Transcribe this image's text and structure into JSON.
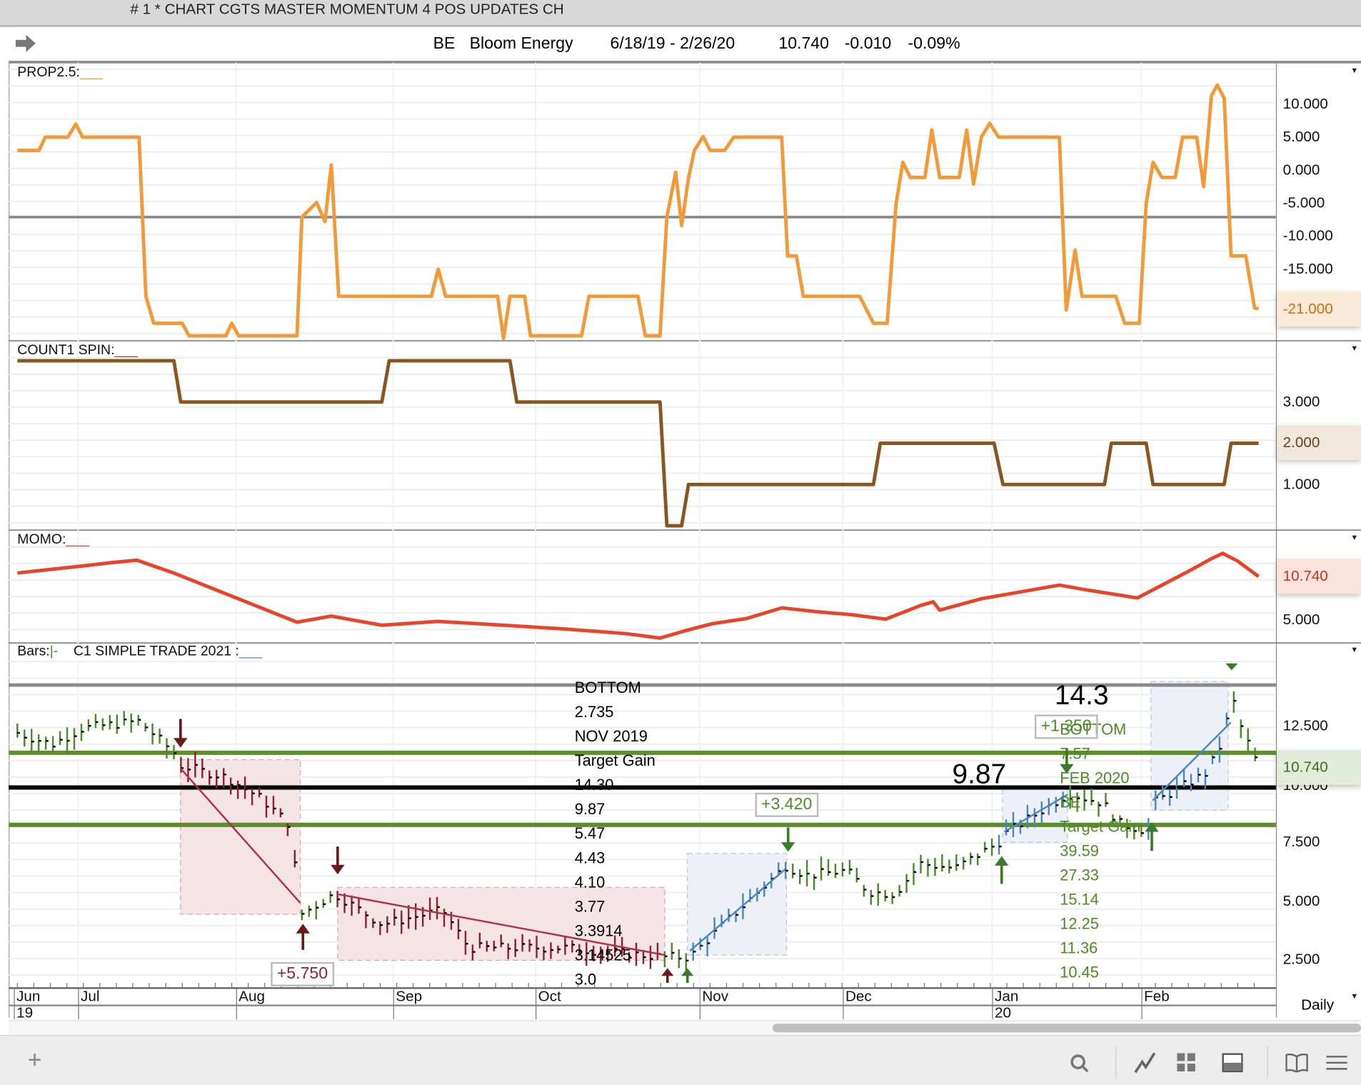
{
  "window": {
    "title": "# 1 * CHART CGTS MASTER MOMENTUM 4 POS UPDATES CH"
  },
  "header": {
    "symbol": "BE",
    "name": "Bloom Energy",
    "range": "6/18/19 - 2/26/20",
    "last": "10.740",
    "change": "-0.010",
    "change_pct": "-0.09%"
  },
  "colors": {
    "prop": "#f29a38",
    "count": "#8a561f",
    "momo": "#e8442a",
    "up": "#4a8a2a",
    "down": "#8c2233",
    "trend_up": "#4a86c0",
    "level_green": "#5e8e2a"
  },
  "panels": {
    "prop": {
      "label": "PROP2.5:",
      "underline": "___",
      "axis": [
        "10.000",
        "5.000",
        "0.000",
        "-5.000",
        "-10.000",
        "-15.000"
      ],
      "current": "-21.000"
    },
    "count": {
      "label": "COUNT1 SPIN:",
      "underline": "___",
      "axis": [
        "3.000",
        "1.000"
      ],
      "current": "2.000"
    },
    "momo": {
      "label": "MOMO:",
      "underline": "___",
      "axis": [
        "5.000"
      ],
      "current": "10.740"
    },
    "bars": {
      "label": "Bars:",
      "bar_style": "|-",
      "study": "C1 SIMPLE TRADE 2021 :",
      "underline": "___",
      "axis": [
        "12.500",
        "10.000",
        "7.500",
        "5.000",
        "2.500"
      ],
      "current": "10.740"
    }
  },
  "annotations": {
    "nov_block": [
      "BOTTOM",
      " 2.735",
      "NOV 2019",
      "Target Gain",
      "14.30",
      "9.87",
      "5.47",
      "4.43",
      "4.10",
      "3.77",
      "3.3914",
      "3.14525",
      "3.0"
    ],
    "feb_block": [
      "BOTTOM",
      "7.57",
      "FEB 2020",
      "BE",
      "Target Gain",
      "39.59",
      "27.33",
      "15.14",
      "12.25",
      "11.36",
      "10.45"
    ],
    "big_target": "14.3",
    "big_level": "9.87",
    "gain_1": "+5.750",
    "gain_2": "+3.420",
    "gain_3": "+1.350"
  },
  "xaxis": {
    "months": [
      "Jun",
      "Jul",
      "Aug",
      "Sep",
      "Oct",
      "Nov",
      "Dec",
      "Jan",
      "Feb"
    ],
    "years": [
      "19",
      "20"
    ],
    "period": "Daily"
  },
  "chart_data": [
    {
      "type": "line",
      "name": "PROP2.5",
      "x_unit": "calendar days since 6/18/19",
      "ylim": [
        -26,
        14
      ],
      "x": [
        0,
        4.4,
        5.7,
        10.3,
        11.9,
        13.3,
        24.8,
        26.2,
        27.8,
        33.6,
        35,
        42.5,
        43.7,
        45.1,
        57,
        58,
        61,
        62.7,
        64,
        65.5,
        84.4,
        85.8,
        87.3,
        97.9,
        99.1,
        100.4,
        103.4,
        104.6,
        115,
        116.5,
        126.5,
        128,
        131,
        132.4,
        134.2,
        135.4,
        136.8,
        138,
        139.8,
        141.2,
        144.2,
        146,
        155.8,
        157,
        158.8,
        160.2,
        171.7,
        174.5,
        177.3,
        179.1,
        180.5,
        182,
        185,
        186.4,
        188,
        192,
        193.5,
        194.9,
        196.5,
        198.2,
        200,
        212.4,
        213.8,
        215.6,
        217,
        223.9,
        225.7,
        228.7,
        230.1,
        231.5,
        233.3,
        236,
        237.5,
        240.4,
        241.8,
        243.4,
        244.6,
        246,
        247.4,
        250.4,
        252.2,
        253
      ],
      "y": [
        3,
        3,
        5,
        5,
        7,
        5,
        5,
        -19.1,
        -23.2,
        -23.2,
        -25.1,
        -25.1,
        -23.2,
        -25.1,
        -25.1,
        -7.1,
        -4.9,
        -7.8,
        0.8,
        -19.1,
        -19.1,
        -15,
        -19.1,
        -19.1,
        -25.5,
        -19.1,
        -19.1,
        -25.1,
        -25.1,
        -19.1,
        -19.1,
        -25.1,
        -25.1,
        -7.1,
        -0.3,
        -8.4,
        -1.2,
        3,
        5.1,
        3,
        3,
        5,
        5,
        -13,
        -13,
        -19.1,
        -19.1,
        -23.2,
        -23.2,
        -5.1,
        1.2,
        -1.1,
        -1.1,
        6.1,
        -1.1,
        -1.1,
        6.1,
        -2.1,
        5,
        7.1,
        5,
        5,
        -21.2,
        -12.1,
        -19.1,
        -19.1,
        -23.2,
        -23.2,
        -5.1,
        1.2,
        -1.1,
        -1.1,
        5,
        5,
        -2.5,
        11.3,
        12.9,
        10.9,
        -13,
        -13,
        -20.9,
        -21
      ]
    },
    {
      "type": "line",
      "name": "COUNT1 SPIN",
      "x_unit": "calendar days since 6/18/19",
      "x": [
        0,
        31.9,
        33.3,
        74.3,
        75.8,
        100.4,
        101.8,
        131,
        132.4,
        135.4,
        136.8,
        174.5,
        175.9,
        199.1,
        200.9,
        221.6,
        223,
        230.1,
        231.5,
        246,
        247.4,
        253
      ],
      "y": [
        4,
        4,
        3,
        3,
        4,
        4,
        3,
        3,
        0,
        0,
        1,
        1,
        2,
        2,
        1,
        1,
        2,
        2,
        1,
        1,
        2,
        2
      ]
    },
    {
      "type": "line",
      "name": "MOMO",
      "x_unit": "calendar days since 6/18/19",
      "x": [
        0,
        7.1,
        14.2,
        19.5,
        24.4,
        31.9,
        57,
        64,
        74.3,
        85.8,
        99.1,
        111.5,
        123.9,
        131,
        136.3,
        141.6,
        148.7,
        155.8,
        162.8,
        169.9,
        177,
        184.1,
        186.7,
        188,
        196.5,
        212.4,
        217.7,
        228.3,
        233.6,
        238.9,
        243.4,
        245.7,
        248.7,
        253
      ],
      "y": [
        11.2,
        11.7,
        12.2,
        12.6,
        12.9,
        11.2,
        4.7,
        5.5,
        4.3,
        4.8,
        4.3,
        3.8,
        3.2,
        2.6,
        3.6,
        4.5,
        5.2,
        6.6,
        6.1,
        5.7,
        5.1,
        6.9,
        7.4,
        6.3,
        7.8,
        9.6,
        9.0,
        7.9,
        9.7,
        11.5,
        13.1,
        13.8,
        12.8,
        10.74
      ]
    },
    {
      "type": "bar",
      "name": "BE price (OHLC bars)",
      "x_unit": "calendar days since 6/18/19",
      "path": [
        [
          0,
          12.2,
          "g"
        ],
        [
          7.1,
          11.7,
          "g"
        ],
        [
          13.3,
          12.4,
          "g"
        ],
        [
          24.8,
          12.7,
          "g"
        ],
        [
          32.7,
          11.2,
          "g"
        ],
        [
          33.3,
          10.8,
          "r"
        ],
        [
          42.5,
          10.3,
          "r"
        ],
        [
          49.6,
          9.4,
          "r"
        ],
        [
          55.8,
          8.2,
          "r"
        ],
        [
          57.5,
          4.4,
          "r"
        ],
        [
          58.4,
          4.5,
          "g"
        ],
        [
          64.6,
          5.3,
          "g"
        ],
        [
          65.5,
          5.2,
          "r"
        ],
        [
          74.3,
          4.0,
          "r"
        ],
        [
          86.7,
          4.6,
          "r"
        ],
        [
          92,
          3.0,
          "r"
        ],
        [
          111.5,
          3.0,
          "r"
        ],
        [
          131.9,
          2.6,
          "r"
        ],
        [
          137.2,
          2.6,
          "g"
        ],
        [
          138,
          2.8,
          "b"
        ],
        [
          146.9,
          4.6,
          "b"
        ],
        [
          156.6,
          6.5,
          "b"
        ],
        [
          161,
          6.1,
          "g"
        ],
        [
          169,
          6.3,
          "g"
        ],
        [
          173.5,
          5.4,
          "g"
        ],
        [
          178.8,
          5.3,
          "g"
        ],
        [
          184.1,
          6.6,
          "g"
        ],
        [
          191.2,
          6.4,
          "g"
        ],
        [
          200,
          7.5,
          "g"
        ],
        [
          201.4,
          7.9,
          "b"
        ],
        [
          214.2,
          9.6,
          "b"
        ],
        [
          221.2,
          9.2,
          "g"
        ],
        [
          224.8,
          8.3,
          "g"
        ],
        [
          230.5,
          8.0,
          "g"
        ],
        [
          231.5,
          9.2,
          "b"
        ],
        [
          242.5,
          10.5,
          "b"
        ],
        [
          246,
          12.0,
          "b"
        ],
        [
          247.4,
          14.0,
          "b"
        ],
        [
          248.7,
          12.8,
          "g"
        ],
        [
          253,
          10.74,
          "g"
        ]
      ],
      "levels": [
        14.3,
        11.0,
        9.87,
        8.3
      ]
    }
  ]
}
